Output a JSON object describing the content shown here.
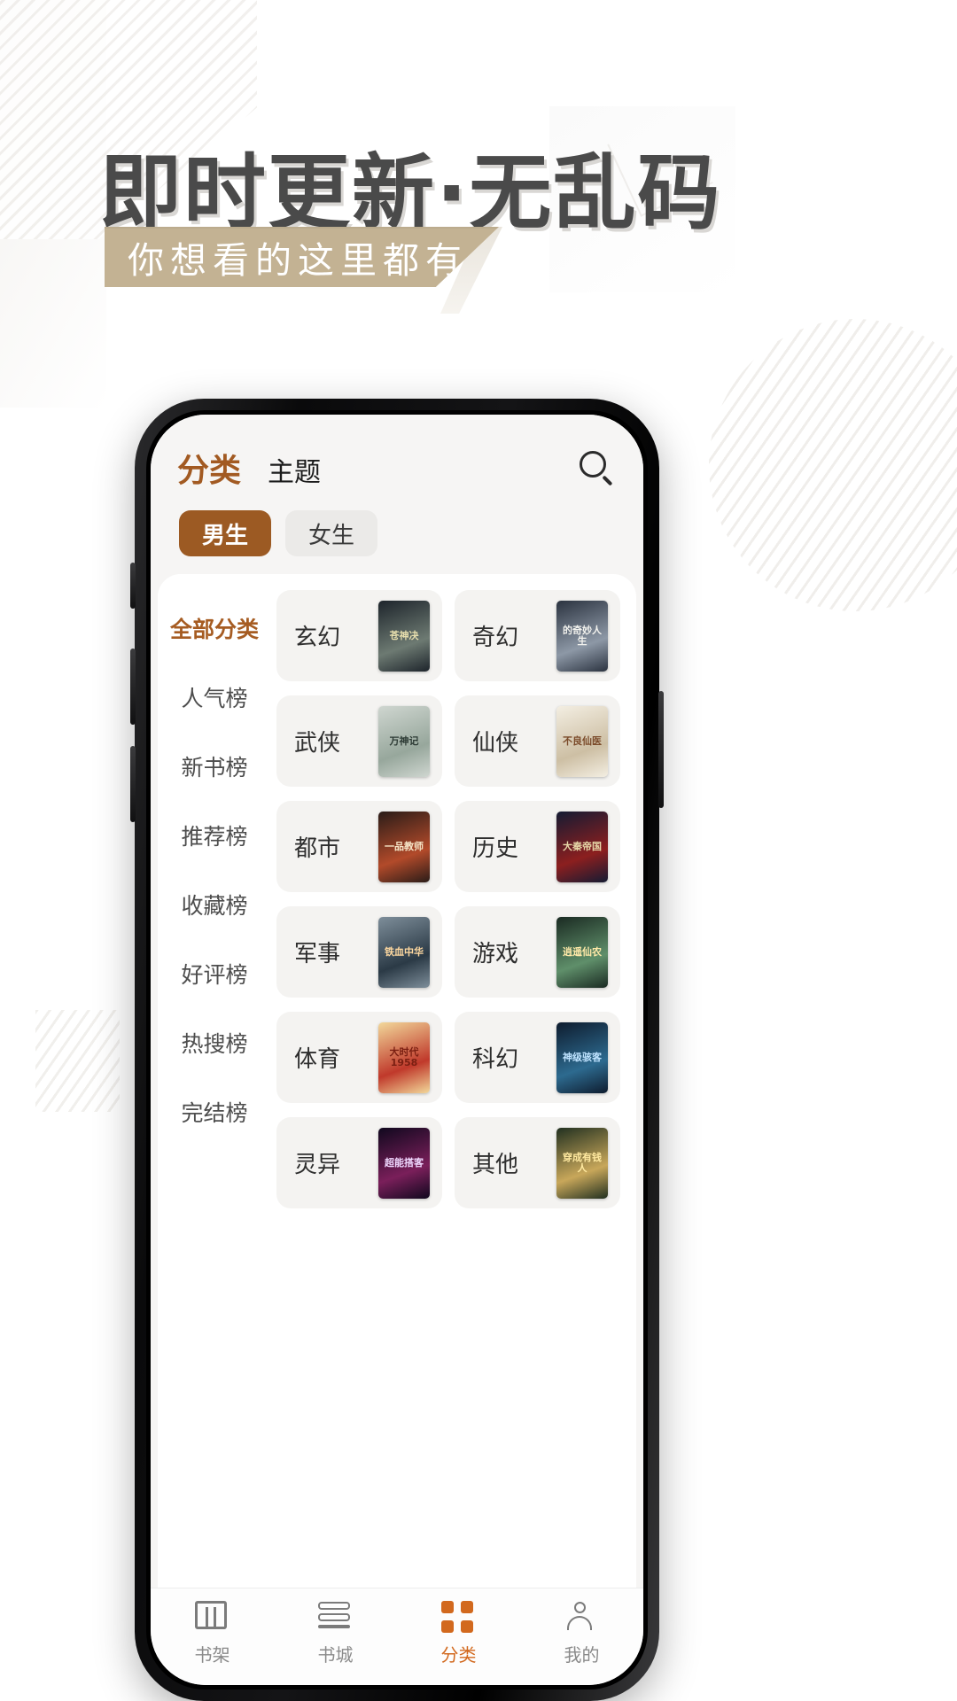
{
  "hero": {
    "headline": "即时更新·无乱码",
    "subtitle": "你想看的这里都有"
  },
  "app": {
    "header": {
      "primary_tab": "分类",
      "secondary_tab": "主题",
      "search_icon": "search-icon"
    },
    "gender_pills": [
      {
        "label": "男生",
        "active": true
      },
      {
        "label": "女生",
        "active": false
      }
    ],
    "sidebar": {
      "items": [
        {
          "label": "全部分类",
          "active": true
        },
        {
          "label": "人气榜",
          "active": false
        },
        {
          "label": "新书榜",
          "active": false
        },
        {
          "label": "推荐榜",
          "active": false
        },
        {
          "label": "收藏榜",
          "active": false
        },
        {
          "label": "好评榜",
          "active": false
        },
        {
          "label": "热搜榜",
          "active": false
        },
        {
          "label": "完结榜",
          "active": false
        }
      ]
    },
    "categories": [
      {
        "name": "玄幻",
        "cover_text": "苍神决",
        "c1": "#1d242b",
        "c2": "#6d7a72",
        "tc": "#e8dfae"
      },
      {
        "name": "奇幻",
        "cover_text": "的奇妙人生",
        "c1": "#2b3340",
        "c2": "#8d98a6",
        "tc": "#f2f2ee"
      },
      {
        "name": "武侠",
        "cover_text": "万神记",
        "c1": "#cfd6d0",
        "c2": "#97a79c",
        "tc": "#2c3a34"
      },
      {
        "name": "仙侠",
        "cover_text": "不良仙医",
        "c1": "#f3eee2",
        "c2": "#cdbfa4",
        "tc": "#7b4b2a"
      },
      {
        "name": "都市",
        "cover_text": "一品教师",
        "c1": "#2a1c18",
        "c2": "#b24a2a",
        "tc": "#f6e6c8"
      },
      {
        "name": "历史",
        "cover_text": "大秦帝国",
        "c1": "#141b33",
        "c2": "#8c1f1f",
        "tc": "#e6d7a8"
      },
      {
        "name": "军事",
        "cover_text": "铁血中华",
        "c1": "#7e8e9a",
        "c2": "#2b3a46",
        "tc": "#ffd9a0"
      },
      {
        "name": "游戏",
        "cover_text": "逍遥仙农",
        "c1": "#1a2a22",
        "c2": "#5f8f6a",
        "tc": "#ffe9a8"
      },
      {
        "name": "体育",
        "cover_text": "大时代1958",
        "c1": "#f2d89a",
        "c2": "#c0392b",
        "tc": "#7a1f12"
      },
      {
        "name": "科幻",
        "cover_text": "神级骇客",
        "c1": "#0e1c2e",
        "c2": "#2d6a8f",
        "tc": "#bfe3ff"
      },
      {
        "name": "灵异",
        "cover_text": "超能搭客",
        "c1": "#10081e",
        "c2": "#7a1f5a",
        "tc": "#f0d8ff"
      },
      {
        "name": "其他",
        "cover_text": "穿成有钱人",
        "c1": "#213020",
        "c2": "#c8a75a",
        "tc": "#ffe9a0"
      }
    ],
    "tabbar": [
      {
        "label": "书架",
        "icon": "bookshelf-icon",
        "active": false
      },
      {
        "label": "书城",
        "icon": "bookstore-icon",
        "active": false
      },
      {
        "label": "分类",
        "icon": "category-grid-icon",
        "active": true
      },
      {
        "label": "我的",
        "icon": "person-icon",
        "active": false
      }
    ]
  },
  "colors": {
    "accent": "#a65c22",
    "pill_active": "#9c5a23",
    "banner": "#c3b293",
    "headline": "#4a4a4a",
    "tab_active": "#d2691e"
  }
}
